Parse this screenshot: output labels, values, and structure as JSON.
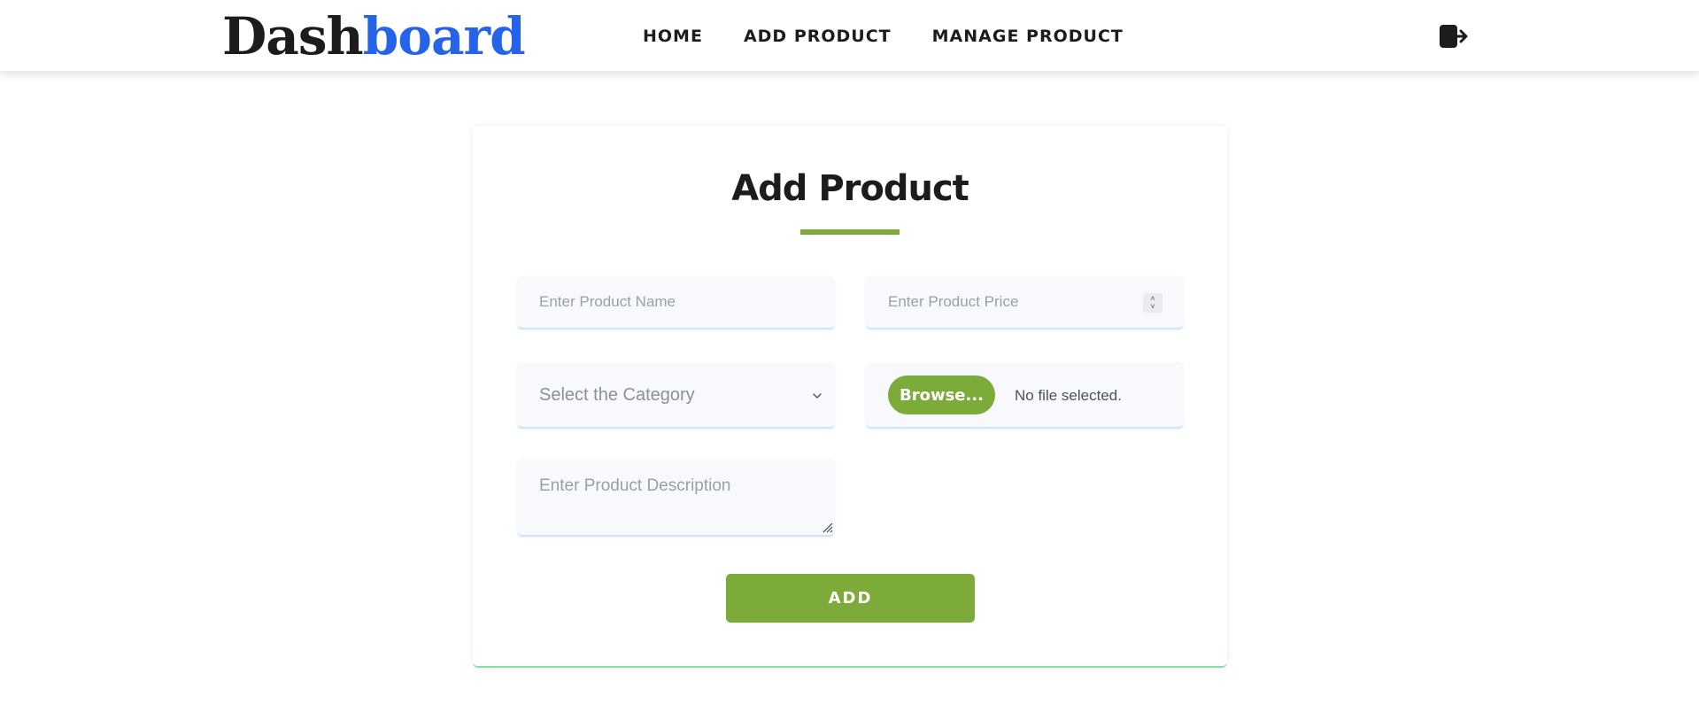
{
  "header": {
    "logo_part1": "Dash",
    "logo_part2": "board",
    "nav": [
      {
        "label": "HOME"
      },
      {
        "label": "ADD PRODUCT"
      },
      {
        "label": "MANAGE PRODUCT"
      }
    ],
    "logout_icon": "logout-icon"
  },
  "form": {
    "title": "Add Product",
    "name_placeholder": "Enter Product Name",
    "price_placeholder": "Enter Product Price",
    "category_selected": "Select the Category",
    "browse_label": "Browse...",
    "file_status": "No file selected.",
    "description_placeholder": "Enter Product Description",
    "submit_label": "ADD"
  },
  "colors": {
    "accent_green": "#7cab3a",
    "logo_blue": "#2563eb",
    "text_dark": "#1c1c1c"
  }
}
